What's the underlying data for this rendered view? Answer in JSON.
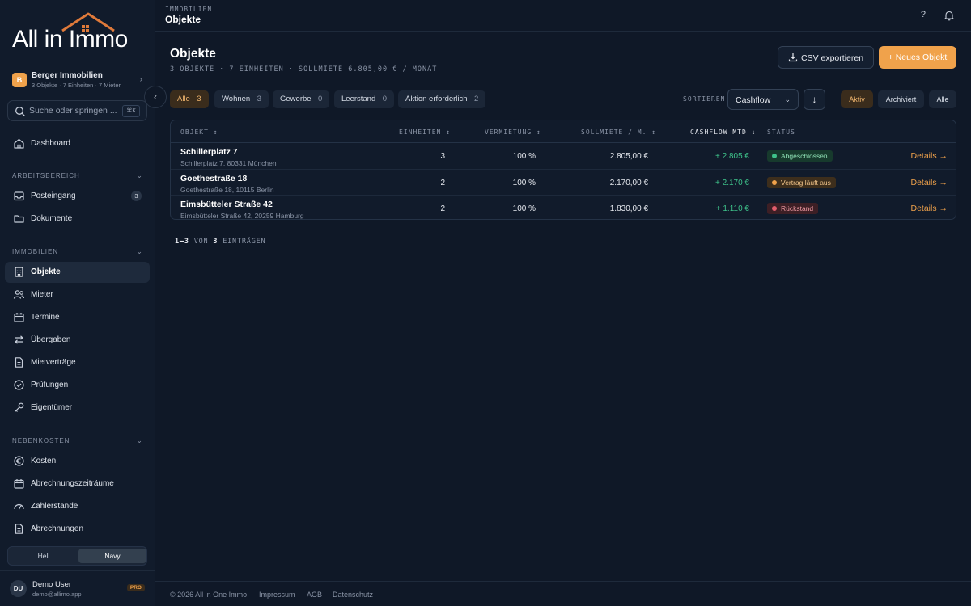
{
  "brand": {
    "logo_text": "All in Immo"
  },
  "org": {
    "initial": "B",
    "name": "Berger Immobilien",
    "summary": "3 Objekte · 7 Einheiten · 7 Mieter"
  },
  "search": {
    "placeholder": "Suche oder springen ...",
    "shortcut": "⌘K"
  },
  "sidebar": {
    "dashboard": "Dashboard",
    "sections": [
      {
        "title": "ARBEITSBEREICH",
        "items": [
          {
            "label": "Posteingang",
            "count": "3"
          },
          {
            "label": "Dokumente"
          }
        ]
      },
      {
        "title": "IMMOBILIEN",
        "items": [
          {
            "label": "Objekte"
          },
          {
            "label": "Mieter"
          },
          {
            "label": "Termine"
          },
          {
            "label": "Übergaben"
          },
          {
            "label": "Mietverträge"
          },
          {
            "label": "Prüfungen"
          },
          {
            "label": "Eigentümer"
          }
        ]
      },
      {
        "title": "NEBENKOSTEN",
        "items": [
          {
            "label": "Kosten"
          },
          {
            "label": "Abrechnungszeiträume"
          },
          {
            "label": "Zählerstände"
          },
          {
            "label": "Abrechnungen"
          }
        ]
      }
    ],
    "active_item": "Objekte"
  },
  "theme": {
    "options": [
      "Hell",
      "Navy"
    ],
    "selected": "Navy"
  },
  "user": {
    "initials": "DU",
    "name": "Demo User",
    "email": "demo@allimo.app",
    "plan": "PRO"
  },
  "topbar": {
    "kicker": "IMMOBILIEN",
    "title": "Objekte",
    "help": "?"
  },
  "page": {
    "title": "Objekte",
    "subtitle": "3 OBJEKTE · 7 EINHEITEN · SOLLMIETE 6.805,00 € / MONAT",
    "csv_button": "CSV exportieren",
    "new_button": "+ Neues Objekt"
  },
  "filters": [
    {
      "label": "Alle",
      "count": "3",
      "active": true
    },
    {
      "label": "Wohnen",
      "count": "3"
    },
    {
      "label": "Gewerbe",
      "count": "0"
    },
    {
      "label": "Leerstand",
      "count": "0"
    },
    {
      "label": "Aktion erforderlich",
      "count": "2"
    }
  ],
  "sort": {
    "label": "SORTIEREN",
    "value": "Cashflow",
    "direction": "↓"
  },
  "status_tabs": [
    {
      "label": "Aktiv",
      "active": true
    },
    {
      "label": "Archiviert"
    },
    {
      "label": "Alle"
    }
  ],
  "table": {
    "headers": {
      "objekt": "OBJEKT",
      "einheiten": "EINHEITEN",
      "vermietung": "VERMIETUNG",
      "sollmiete": "SOLLMIETE / M.",
      "cashflow": "CASHFLOW MTD",
      "status": "STATUS"
    },
    "rows": [
      {
        "name": "Schillerplatz 7",
        "address": "Schillerplatz 7, 80331 München",
        "einheiten": "3",
        "vermietung": "100 %",
        "sollmiete": "2.805,00 €",
        "cashflow": "+ 2.805 €",
        "status": "Abgeschlossen",
        "status_color": "green",
        "action": "Details →"
      },
      {
        "name": "Goethestraße 18",
        "address": "Goethestraße 18, 10115 Berlin",
        "einheiten": "2",
        "vermietung": "100 %",
        "sollmiete": "2.170,00 €",
        "cashflow": "+ 2.170 €",
        "status": "Vertrag läuft aus",
        "status_color": "amber",
        "action": "Details →"
      },
      {
        "name": "Eimsbütteler Straße 42",
        "address": "Eimsbütteler Straße 42, 20259 Hamburg",
        "einheiten": "2",
        "vermietung": "100 %",
        "sollmiete": "1.830,00 €",
        "cashflow": "+ 1.110 €",
        "status": "Rückstand",
        "status_color": "red",
        "action": "Details →"
      }
    ]
  },
  "pagination": {
    "range": "1–3",
    "von": "VON",
    "total": "3",
    "suffix": "EINTRÄGEN"
  },
  "footer": {
    "copyright": "© 2026 All in One Immo",
    "links": [
      "Impressum",
      "AGB",
      "Datenschutz"
    ]
  },
  "colors": {
    "accent": "#f0a24b",
    "positive": "#3ec28a",
    "danger": "#e25d6c",
    "background": "#0f1827"
  }
}
